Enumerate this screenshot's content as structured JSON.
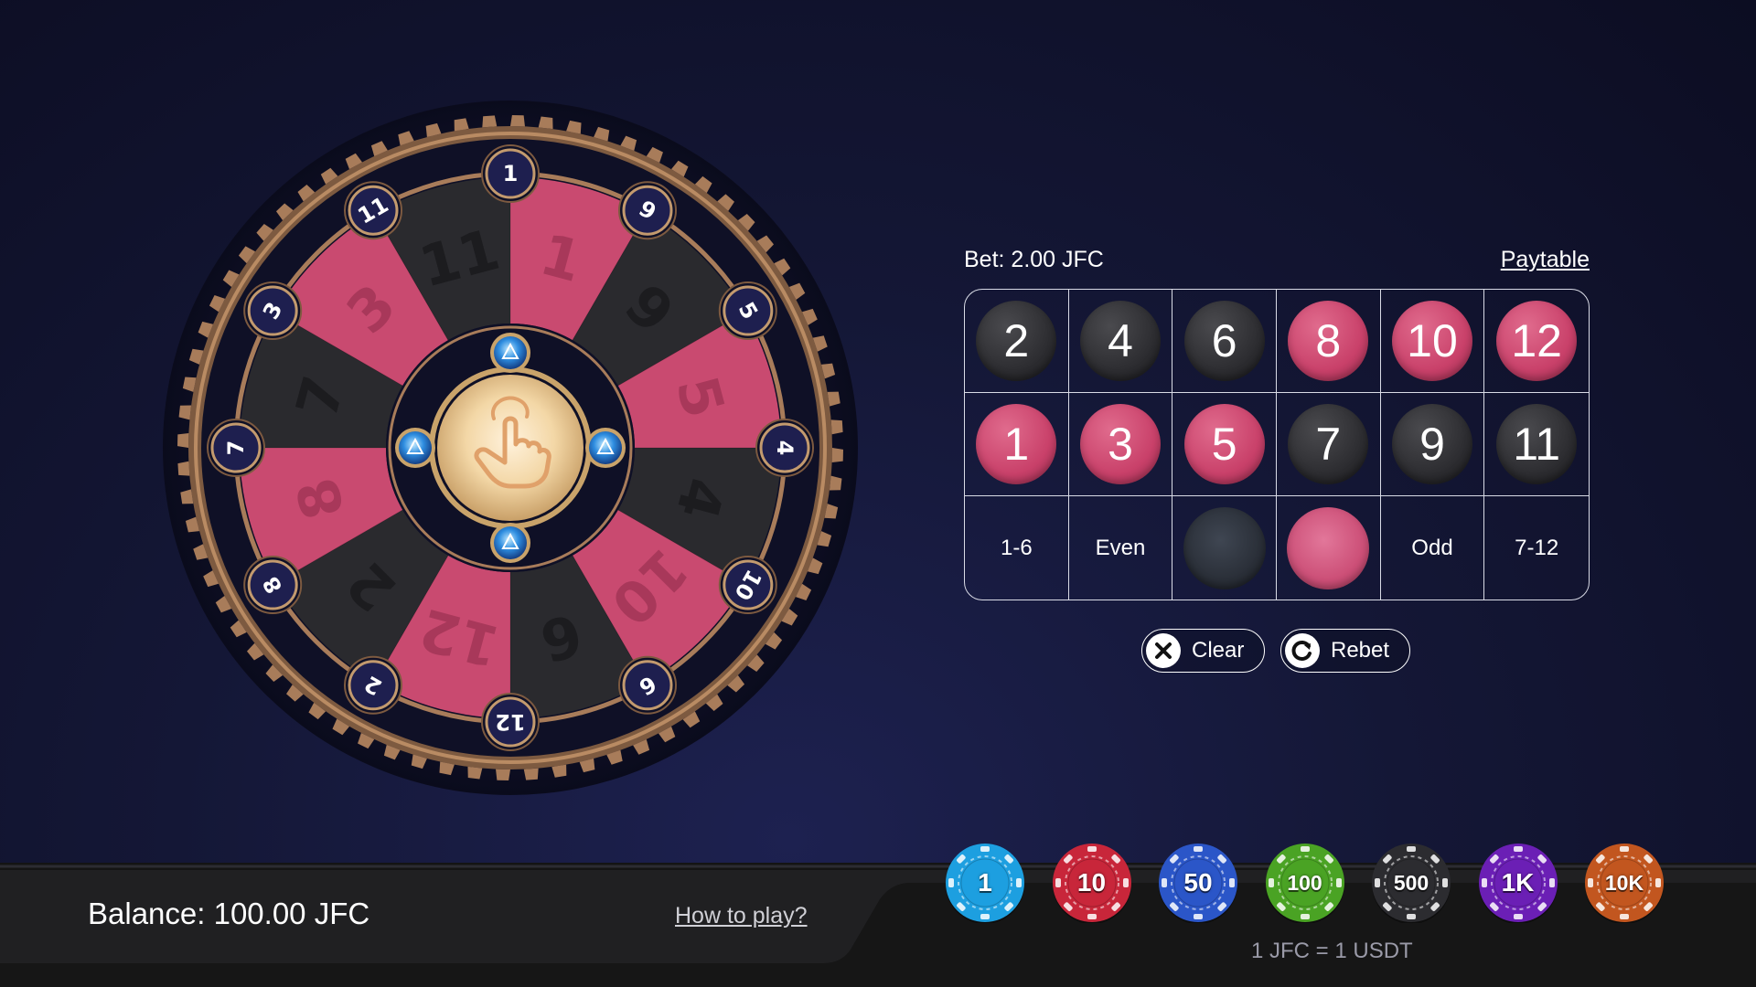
{
  "wheel": {
    "segments": [
      {
        "number": "1",
        "color": "red"
      },
      {
        "number": "9",
        "color": "black"
      },
      {
        "number": "5",
        "color": "red"
      },
      {
        "number": "4",
        "color": "black"
      },
      {
        "number": "10",
        "color": "red"
      },
      {
        "number": "6",
        "color": "black"
      },
      {
        "number": "12",
        "color": "red"
      },
      {
        "number": "2",
        "color": "black"
      },
      {
        "number": "8",
        "color": "red"
      },
      {
        "number": "7",
        "color": "black"
      },
      {
        "number": "3",
        "color": "red"
      },
      {
        "number": "11",
        "color": "black"
      }
    ],
    "spin_icon": "pointing-hand-icon",
    "colors": {
      "red": "#c94a70",
      "black": "#2a2a2e",
      "rim": "#a87c5a",
      "badge": "#1e1f4f"
    }
  },
  "bet": {
    "label": "Bet: 2.00 JFC",
    "paytable": "Paytable"
  },
  "board": {
    "rows": [
      [
        {
          "label": "2",
          "color": "black"
        },
        {
          "label": "4",
          "color": "black"
        },
        {
          "label": "6",
          "color": "black"
        },
        {
          "label": "8",
          "color": "red"
        },
        {
          "label": "10",
          "color": "red"
        },
        {
          "label": "12",
          "color": "red"
        }
      ],
      [
        {
          "label": "1",
          "color": "red"
        },
        {
          "label": "3",
          "color": "red"
        },
        {
          "label": "5",
          "color": "red"
        },
        {
          "label": "7",
          "color": "black"
        },
        {
          "label": "9",
          "color": "black"
        },
        {
          "label": "11",
          "color": "black"
        }
      ]
    ],
    "outside": [
      {
        "label": "1-6",
        "kind": "text"
      },
      {
        "label": "Even",
        "kind": "text"
      },
      {
        "label": "",
        "kind": "black"
      },
      {
        "label": "",
        "kind": "red"
      },
      {
        "label": "Odd",
        "kind": "text"
      },
      {
        "label": "7-12",
        "kind": "text"
      }
    ]
  },
  "actions": {
    "clear": "Clear",
    "rebet": "Rebet"
  },
  "footer": {
    "balance": "Balance: 100.00 JFC",
    "how_to_play": "How to play?",
    "rate": "1 JFC = 1 USDT"
  },
  "chips": [
    {
      "label": "1",
      "color": "#1d9fe0"
    },
    {
      "label": "10",
      "color": "#c8263a"
    },
    {
      "label": "50",
      "color": "#2b56c8"
    },
    {
      "label": "100",
      "color": "#4aa324"
    },
    {
      "label": "500",
      "color": "#2c2c30"
    },
    {
      "label": "1K",
      "color": "#6b1fb5"
    },
    {
      "label": "10K",
      "color": "#c2561f"
    }
  ]
}
